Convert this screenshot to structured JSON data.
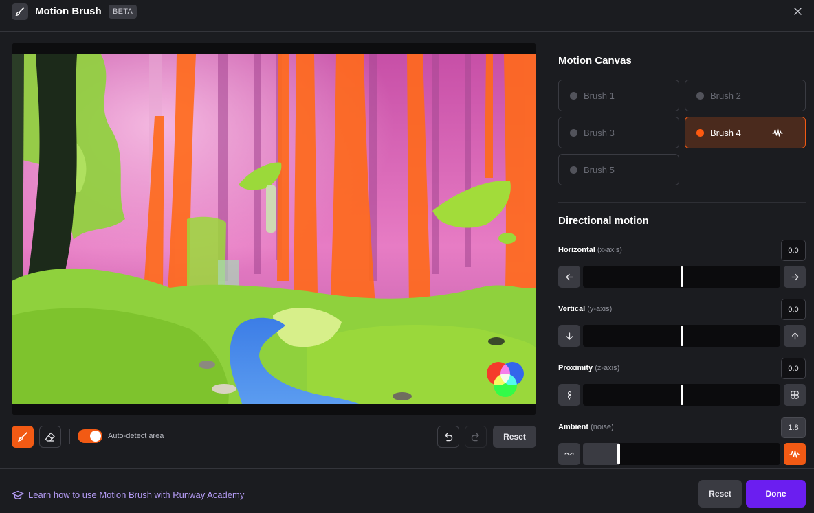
{
  "header": {
    "title": "Motion Brush",
    "badge": "BETA",
    "icons": {
      "app": "paintbrush-icon",
      "close": "close-icon"
    }
  },
  "canvas": {
    "image": "forest scene with painted motion brush masks",
    "mask_colors": {
      "brush_green": "#9bd93a",
      "brush_orange": "#ff6a1a",
      "brush_magenta": "#ff4fbf",
      "brush_blue": "#3d8bff"
    },
    "toolbar": {
      "auto_detect_label": "Auto-detect area",
      "auto_detect_on": true,
      "reset_label": "Reset",
      "icons": [
        "paintbrush-icon",
        "eraser-icon",
        "undo-icon",
        "redo-icon"
      ]
    }
  },
  "motion_canvas": {
    "title": "Motion Canvas",
    "brushes": [
      {
        "label": "Brush 1",
        "active": false
      },
      {
        "label": "Brush 2",
        "active": false
      },
      {
        "label": "Brush 3",
        "active": false
      },
      {
        "label": "Brush 4",
        "active": true
      },
      {
        "label": "Brush 5",
        "active": false
      }
    ],
    "active_indicator_icon": "waveform-icon"
  },
  "directional_motion": {
    "title": "Directional motion",
    "sliders": [
      {
        "name": "Horizontal",
        "axis": "(x-axis)",
        "value": "0.0",
        "level": 0.5,
        "left_icon": "arrow-left-icon",
        "right_icon": "arrow-right-icon"
      },
      {
        "name": "Vertical",
        "axis": "(y-axis)",
        "value": "0.0",
        "level": 0.5,
        "left_icon": "arrow-down-icon",
        "right_icon": "arrow-up-icon"
      },
      {
        "name": "Proximity",
        "axis": "(z-axis)",
        "value": "0.0",
        "level": 0.5,
        "left_icon": "shrink-flower-icon",
        "right_icon": "expand-flower-icon"
      },
      {
        "name": "Ambient",
        "axis": "(noise)",
        "value": "1.8",
        "level": 0.18,
        "left_icon": "calm-wave-icon",
        "right_icon": "noise-wave-icon"
      }
    ]
  },
  "footer": {
    "academy_link": "Learn how to use Motion Brush with Runway Academy",
    "academy_icon": "graduation-cap-icon",
    "reset_label": "Reset",
    "done_label": "Done"
  },
  "colors": {
    "accent_orange": "#f25a14",
    "done_purple": "#6b1ef0",
    "link_purple": "#b59cf5",
    "background": "#1b1c20"
  }
}
